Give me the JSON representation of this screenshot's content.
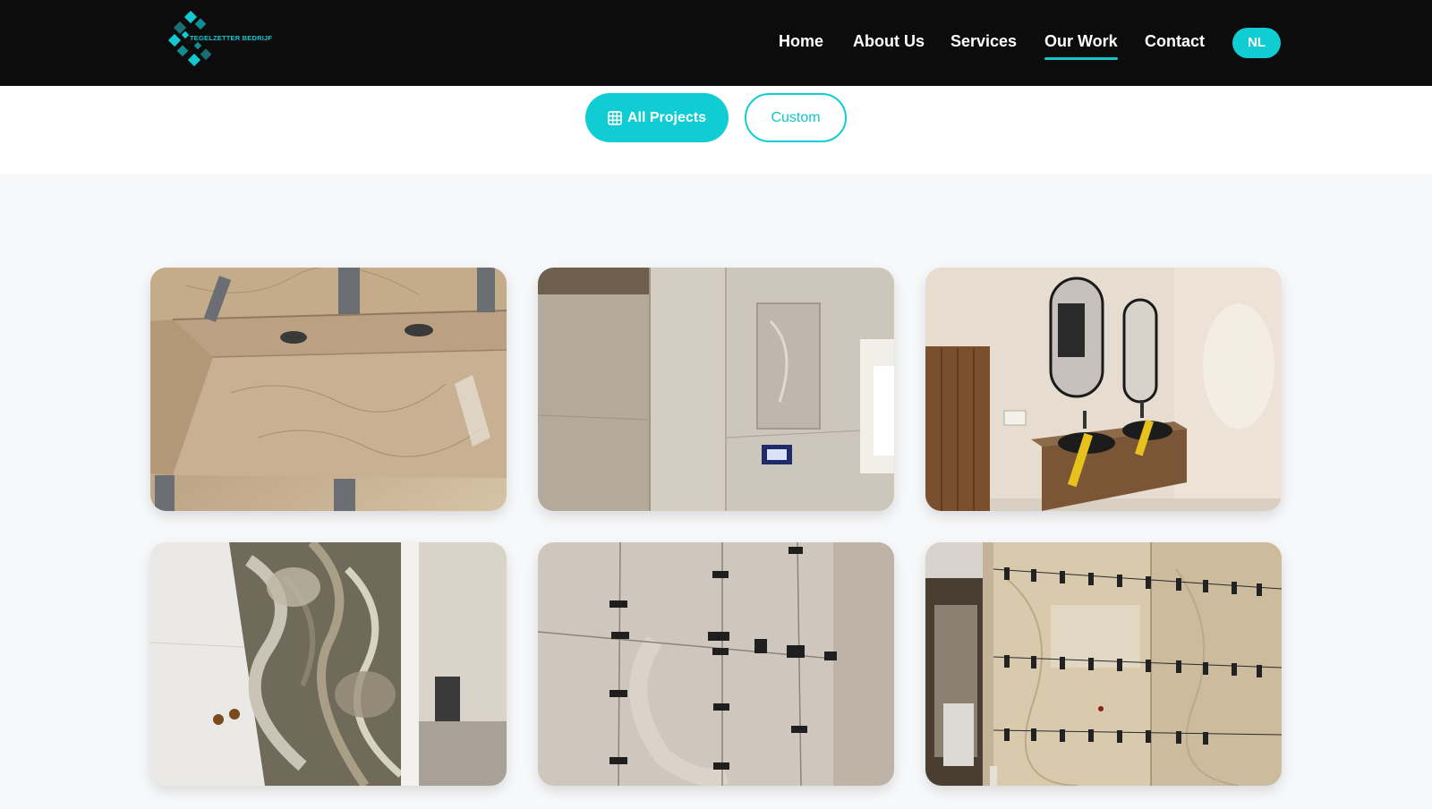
{
  "header": {
    "logo_text": "TEGELZETTER BEDRIJF",
    "nav": [
      {
        "label": "Home",
        "active": false
      },
      {
        "label": "About Us",
        "active": false
      },
      {
        "label": "Services",
        "active": false
      },
      {
        "label": "Our Work",
        "active": true
      },
      {
        "label": "Contact",
        "active": false
      }
    ],
    "lang_label": "NL"
  },
  "filters": {
    "all_label": "All Projects",
    "all_icon": "grid-icon",
    "custom_label": "Custom"
  },
  "colors": {
    "accent": "#10cdd3",
    "header_bg": "#0c0c0c",
    "page_bg": "#f7f8f9"
  },
  "gallery": {
    "items": [
      {
        "subject": "marble bathtub niche tiling"
      },
      {
        "subject": "shower wall with recessed niche"
      },
      {
        "subject": "double vanity with round mirrors"
      },
      {
        "subject": "onyx feature wall slab"
      },
      {
        "subject": "large format tiles with leveling clips"
      },
      {
        "subject": "marble wall with leveling clips"
      }
    ]
  }
}
